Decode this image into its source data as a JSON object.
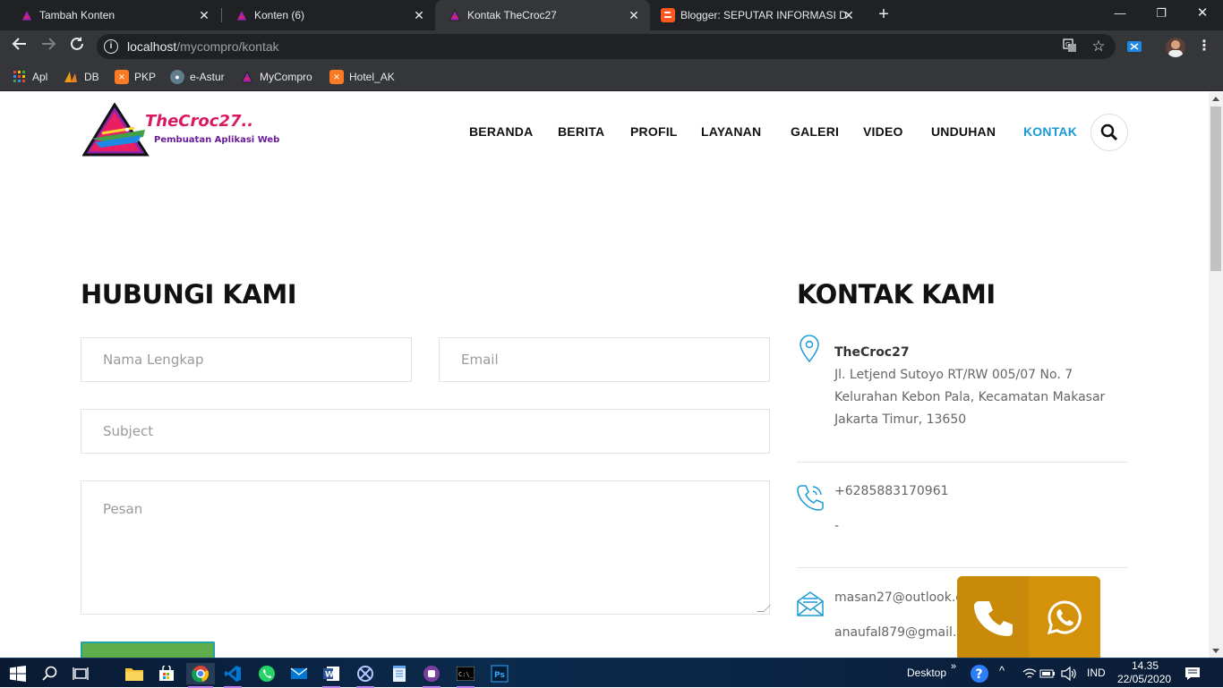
{
  "browser": {
    "tabs": [
      {
        "title": "Tambah Konten",
        "active": false
      },
      {
        "title": "Konten (6)",
        "active": false
      },
      {
        "title": "Kontak TheCroc27",
        "active": true
      },
      {
        "title": "Blogger: SEPUTAR INFORMASI D",
        "active": false
      }
    ],
    "url_host": "localhost",
    "url_path": "/mycompro/kontak",
    "bookmarks": [
      "Apl",
      "DB",
      "PKP",
      "e-Astur",
      "MyCompro",
      "Hotel_AK"
    ]
  },
  "site": {
    "logo_title": "TheCroc27..",
    "logo_subtitle": "Pembuatan Aplikasi Web",
    "nav": [
      "BERANDA",
      "BERITA",
      "PROFIL",
      "LAYANAN",
      "GALERI",
      "VIDEO",
      "UNDUHAN",
      "KONTAK"
    ],
    "active_nav": "KONTAK",
    "accent_color": "#1a9ad6"
  },
  "form": {
    "heading": "HUBUNGI KAMI",
    "name_placeholder": "Nama Lengkap",
    "email_placeholder": "Email",
    "subject_placeholder": "Subject",
    "message_placeholder": "Pesan"
  },
  "contact": {
    "heading": "KONTAK KAMI",
    "company": "TheCroc27",
    "address_lines": [
      "Jl. Letjend Sutoyo RT/RW 005/07 No. 7",
      "Kelurahan Kebon Pala, Kecamatan Makasar",
      "Jakarta Timur, 13650"
    ],
    "phone": "+6285883170961",
    "phone2": "-",
    "email1": "masan27@outlook.c",
    "email2": "anaufal879@gmail."
  },
  "taskbar": {
    "desktop_label": "Desktop",
    "language": "IND",
    "time": "14.35",
    "date": "22/05/2020"
  }
}
